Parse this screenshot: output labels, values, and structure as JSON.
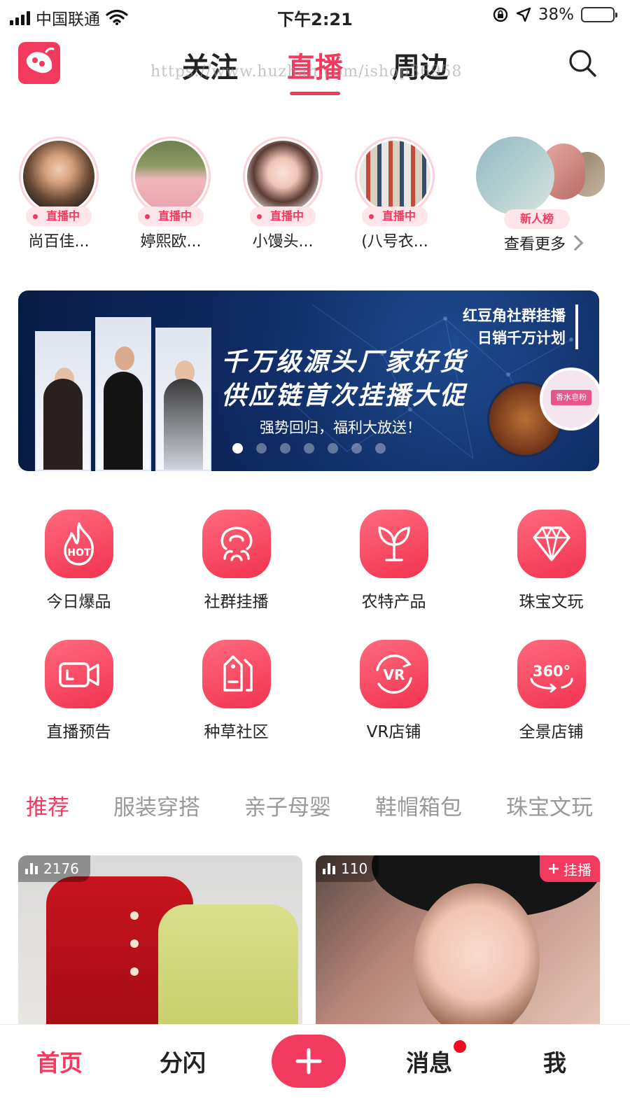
{
  "status_bar": {
    "carrier": "中国联通",
    "time": "下午2:21",
    "battery": "38%",
    "battery_level": 0.38
  },
  "nav": {
    "tabs": [
      {
        "label": "关注",
        "active": false
      },
      {
        "label": "直播",
        "active": true
      },
      {
        "label": "周边",
        "active": false
      }
    ],
    "watermark": "https://www.huzhan.com/ishop36958"
  },
  "live_row": {
    "items": [
      {
        "name": "尚百佳...",
        "badge": "直播中"
      },
      {
        "name": "婷熙欧...",
        "badge": "直播中"
      },
      {
        "name": "小馒头...",
        "badge": "直播中"
      },
      {
        "name": "(八号衣...",
        "badge": "直播中"
      }
    ],
    "more": {
      "badge": "新人榜",
      "label": "查看更多"
    }
  },
  "banner": {
    "corner_line1": "红豆角社群挂播",
    "corner_line2": "日销千万计划",
    "title_line1": "千万级源头厂家好货",
    "title_line2": "供应链首次挂播大促",
    "subtitle": "强势回归，福利大放送！",
    "product_label": "香水皂粉",
    "dots": 7,
    "active_dot": 0
  },
  "categories": [
    {
      "label": "今日爆品",
      "icon": "hot-fire-icon",
      "icon_text": "HOT"
    },
    {
      "label": "社群挂播",
      "icon": "community-icon"
    },
    {
      "label": "农特产品",
      "icon": "sprout-icon"
    },
    {
      "label": "珠宝文玩",
      "icon": "diamond-icon"
    },
    {
      "label": "直播预告",
      "icon": "video-camera-icon"
    },
    {
      "label": "种草社区",
      "icon": "tag-icon"
    },
    {
      "label": "VR店铺",
      "icon": "vr-icon",
      "icon_text": "VR"
    },
    {
      "label": "全景店铺",
      "icon": "panorama-360-icon",
      "icon_text": "360°"
    }
  ],
  "content_tabs": [
    {
      "label": "推荐",
      "active": true
    },
    {
      "label": "服装穿搭",
      "active": false
    },
    {
      "label": "亲子母婴",
      "active": false
    },
    {
      "label": "鞋帽箱包",
      "active": false
    },
    {
      "label": "珠宝文玩",
      "active": false
    }
  ],
  "feed": [
    {
      "viewers": "2176"
    },
    {
      "viewers": "110",
      "action": "挂播"
    }
  ],
  "bottom_nav": {
    "items": [
      {
        "label": "首页",
        "active": true
      },
      {
        "label": "分闪",
        "active": false
      },
      {
        "label": "消息",
        "active": false,
        "badge_dot": true
      },
      {
        "label": "我",
        "active": false
      }
    ]
  },
  "colors": {
    "accent": "#f23a5e",
    "banner_bg": "#0f2b63"
  }
}
